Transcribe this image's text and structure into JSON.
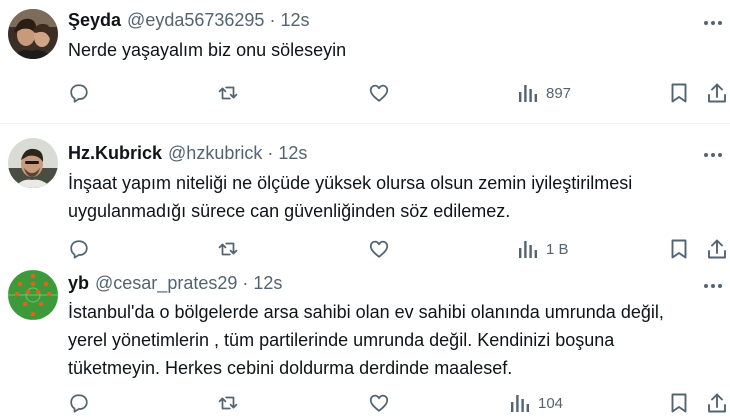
{
  "tweets": [
    {
      "name": "Şeyda",
      "handle": "@eyda56736295",
      "dot": "·",
      "time": "12s",
      "lines": [
        "Nerde yaşayalım biz onu söleseyin"
      ],
      "views": "897"
    },
    {
      "name": "Hz.Kubrick",
      "handle": "@hzkubrick",
      "dot": "·",
      "time": "12s",
      "lines": [
        "İnşaat yapım niteliği ne ölçüde yüksek olursa olsun zemin iyileştirilmesi",
        "uygulanmadığı sürece can güvenliğinden söz edilemez."
      ],
      "views": "1 B"
    },
    {
      "name": "yb",
      "handle": "@cesar_prates29",
      "dot": "·",
      "time": "12s",
      "lines": [
        "İstanbul'da o bölgelerde arsa sahibi olan ev sahibi olanında umrunda değil,",
        "yerel yönetimlerin , tüm partilerinde umrunda değil. Kendinizi boşuna",
        "tüketmeyin. Herkes cebini doldurma derdinde maalesef."
      ],
      "views": "104"
    }
  ],
  "icons": {
    "reply": "reply-icon",
    "retweet": "retweet-icon",
    "like": "like-icon",
    "views": "views-icon",
    "bookmark": "bookmark-icon",
    "share": "share-icon",
    "more": "more-icon"
  },
  "colors": {
    "text": "#0f1419",
    "secondary": "#536471",
    "divider": "#eff3f4"
  }
}
